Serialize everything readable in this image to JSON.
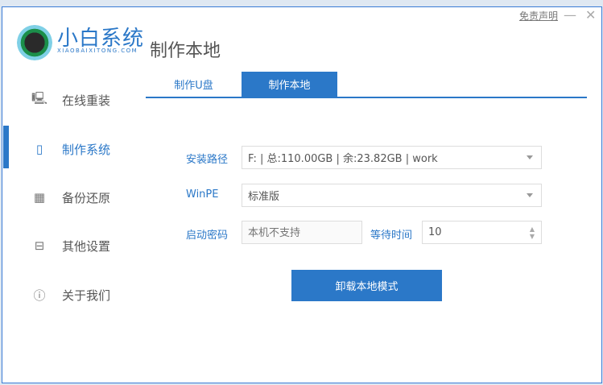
{
  "brand": {
    "name": "小白系统",
    "sub": "XIAOBAIXITONG.COM"
  },
  "header": {
    "title": "制作本地",
    "disclaimer": "免责声明",
    "minimize": "—",
    "close": "✕"
  },
  "sidebar": {
    "items": [
      {
        "label": "在线重装",
        "icon": "monitor-icon",
        "glyph": "🖳"
      },
      {
        "label": "制作系统",
        "icon": "usb-icon",
        "glyph": "▯"
      },
      {
        "label": "备份还原",
        "icon": "grid-icon",
        "glyph": "▦"
      },
      {
        "label": "其他设置",
        "icon": "briefcase-icon",
        "glyph": "⊟"
      },
      {
        "label": "关于我们",
        "icon": "info-icon",
        "glyph": "ⓘ"
      }
    ],
    "active": 1
  },
  "tabs": [
    {
      "label": "制作U盘"
    },
    {
      "label": "制作本地"
    }
  ],
  "form": {
    "path_label": "安装路径",
    "path_value": "F: | 总:110.00GB | 余:23.82GB | work",
    "winpe_label": "WinPE",
    "winpe_value": "标准版",
    "pwd_label": "启动密码",
    "pwd_placeholder": "本机不支持",
    "wait_label": "等待时间",
    "wait_value": "10"
  },
  "action": {
    "label": "卸载本地模式"
  },
  "colors": {
    "accent": "#2b78c8"
  }
}
